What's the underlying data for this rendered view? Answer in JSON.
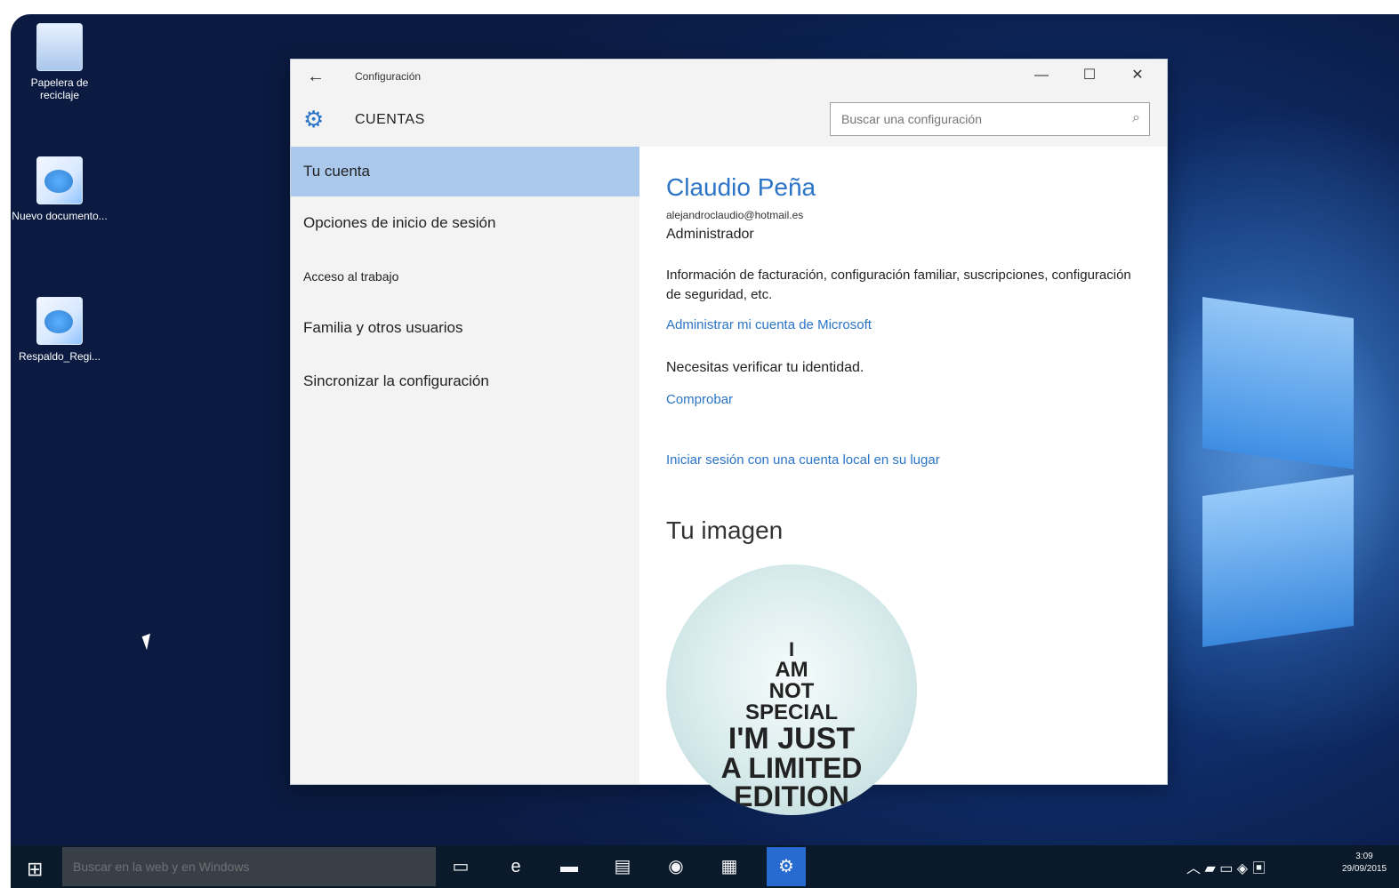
{
  "desktop": {
    "icons": [
      {
        "label": "Papelera de reciclaje",
        "icon": "recycle-bin-icon"
      },
      {
        "label": "Nuevo documento...",
        "icon": "document-icon"
      },
      {
        "label": "Respaldo_Regi...",
        "icon": "registry-icon"
      }
    ]
  },
  "window": {
    "title": "Configuración",
    "controls": {
      "minimize": "—",
      "maximize": "☐",
      "close": "✕"
    },
    "header": {
      "section": "CUENTAS",
      "search_placeholder": "Buscar una configuración"
    },
    "sidebar": {
      "items": [
        {
          "label": "Tu cuenta",
          "active": true
        },
        {
          "label": "Opciones de inicio de sesión",
          "active": false
        },
        {
          "label": "Acceso al trabajo",
          "active": false
        },
        {
          "label": "Familia y otros usuarios",
          "active": false
        },
        {
          "label": "Sincronizar la configuración",
          "active": false
        }
      ]
    },
    "content": {
      "name": "Claudio Peña",
      "email": "alejandroclaudio@hotmail.es",
      "role": "Administrador",
      "info": "Información de facturación, configuración familiar, suscripciones, configuración de seguridad, etc.",
      "manage_link": "Administrar mi cuenta de Microsoft",
      "verify_text": "Necesitas verificar tu identidad.",
      "verify_link": "Comprobar",
      "local_link": "Iniciar sesión con una cuenta local en su lugar",
      "image_title": "Tu imagen",
      "avatar_text": [
        "I",
        "AM",
        "NOT",
        "SPECIAL",
        "I'M JUST",
        "A LIMITED",
        "EDITION"
      ]
    }
  },
  "taskbar": {
    "search_placeholder": "Buscar en la web y en Windows",
    "time": "3:09",
    "date": "29/09/2015"
  }
}
